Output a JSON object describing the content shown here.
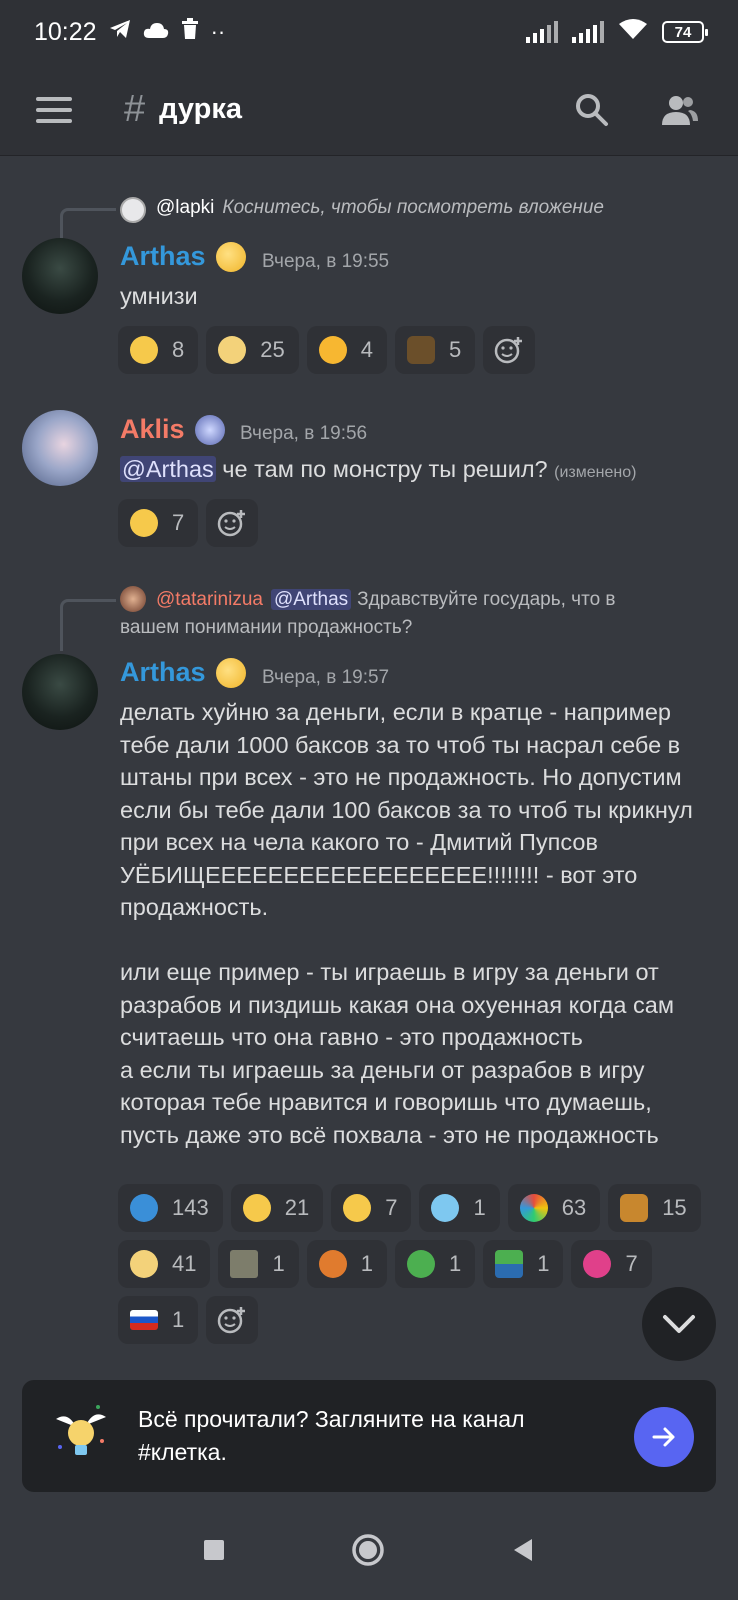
{
  "status_bar": {
    "time": "10:22",
    "battery": "74"
  },
  "header": {
    "hash": "#",
    "channel": "дурка"
  },
  "colors": {
    "accent": "#5865f2",
    "arthas": "#3498db",
    "aklis": "#f47b67",
    "bg": "#36393f"
  },
  "messages": [
    {
      "reply": {
        "name": "@lapki",
        "text": "Коснитесь, чтобы посмотреть вложение"
      },
      "author": "Arthas",
      "time": "Вчера, в 19:55",
      "lines": [
        "умнизи"
      ],
      "reactions": [
        {
          "icon": "thinking-face-emoji",
          "count": "8"
        },
        {
          "icon": "trollface-emoji",
          "count": "25"
        },
        {
          "icon": "smiling-face-emoji",
          "count": "4"
        },
        {
          "icon": "mask-emoji",
          "count": "5"
        }
      ]
    },
    {
      "author": "Aklis",
      "time": "Вчера, в 19:56",
      "mention": "@Arthas",
      "text": " че там по монстру ты решил?",
      "edited": "(изменено)",
      "reactions": [
        {
          "icon": "thinking-face-emoji",
          "count": "7"
        }
      ]
    },
    {
      "reply": {
        "name": "@tatarinizua",
        "mention": "@Arthas",
        "text_line1": "Здравствуйте государь, что в",
        "text_line2": "вашем понимании продажность?"
      },
      "author": "Arthas",
      "time": "Вчера, в 19:57",
      "lines": [
        "делать хуйню за деньги, если в кратце - например",
        "тебе дали 1000 баксов за то чтоб ты насрал себе в",
        "штаны при всех - это не продажность. Но допустим",
        "если бы тебе дали 100 баксов за то чтоб ты крикнул",
        "при всех на чела какого то - Дмитий Пупсов",
        "УЁБИЩЕЕЕЕЕЕЕЕЕЕЕЕЕЕЕЕЕЕ!!!!!!!! - вот это",
        "продажность.",
        "",
        "или еще пример - ты играешь в игру за деньги от",
        "разрабов и пиздишь какая она охуенная когда сам",
        "считаешь что она гавно - это продажность",
        "а если ты играешь за деньги от разрабов в игру",
        "которая тебе нравится и говоришь что думаешь,",
        "пусть даже это всё похвала - это не продажность"
      ],
      "reactions": [
        {
          "icon": "fish-emoji",
          "count": "143"
        },
        {
          "icon": "raised-eyebrow-emoji",
          "count": "21"
        },
        {
          "icon": "thinking-face-emoji",
          "count": "7"
        },
        {
          "icon": "blue-face-emoji",
          "count": "1"
        },
        {
          "icon": "clown-emoji",
          "count": "63"
        },
        {
          "icon": "king-emoji",
          "count": "15"
        },
        {
          "icon": "trollface-emoji",
          "count": "41"
        },
        {
          "icon": "picture-emoji",
          "count": "1"
        },
        {
          "icon": "angry-face-emoji",
          "count": "1"
        },
        {
          "icon": "pepe-frog-emoji",
          "count": "1"
        },
        {
          "icon": "pepe-sleep-emoji",
          "count": "1"
        },
        {
          "icon": "pink-fish-emoji",
          "count": "7"
        },
        {
          "icon": "russian-flag-emoji",
          "count": "1"
        }
      ]
    }
  ],
  "banner": {
    "line1": "Всё прочитали? Загляните на канал",
    "line2": "#клетка."
  }
}
